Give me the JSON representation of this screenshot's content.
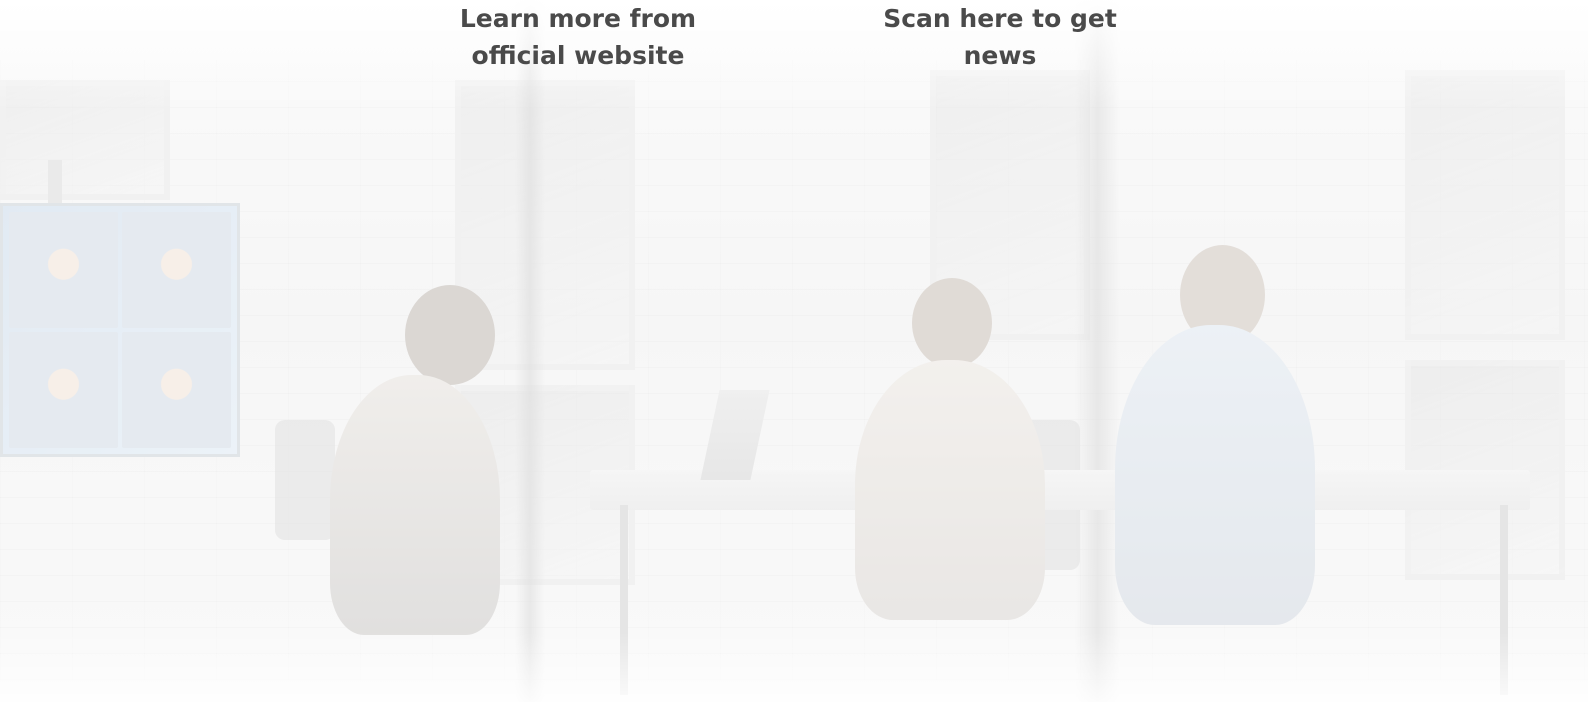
{
  "captions": {
    "website": "Learn more from official website",
    "news": "Scan here to get news"
  },
  "background": {
    "scene_icon": "office-meeting-photo-icon",
    "tint": "#f2f2f2",
    "text_color": "#4a4a4a"
  }
}
